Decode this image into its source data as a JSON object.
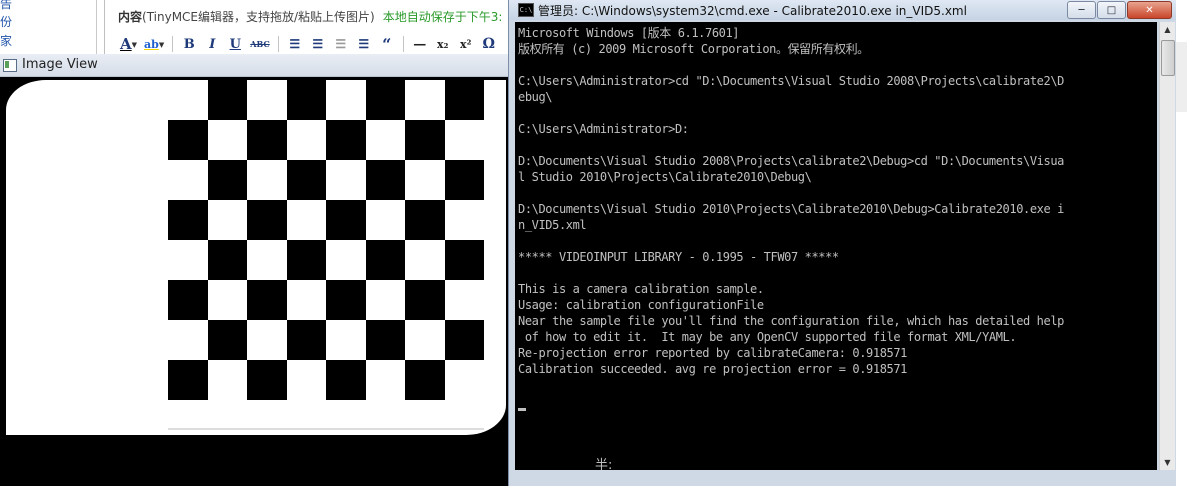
{
  "left_nav": {
    "items": [
      "告",
      "份",
      "家"
    ]
  },
  "editor": {
    "content_label": "内容",
    "content_hint": "(TinyMCE编辑器，支持拖放/粘贴上传图片)",
    "autosave": "本地自动保存于下午3:",
    "toolbar": [
      "A",
      "ab",
      "B",
      "I",
      "U",
      "ABC",
      "☰",
      "☰",
      "☰",
      "☰",
      "“",
      "—",
      "x₂",
      "x²",
      "Ω"
    ]
  },
  "image_view": {
    "title": "Image View",
    "board": {
      "columns": 8,
      "rows": 8
    }
  },
  "cmd_window": {
    "title": "管理员: C:\\Windows\\system32\\cmd.exe - Calibrate2010.exe  in_VID5.xml",
    "controls": {
      "minimize": "─",
      "maximize": "□",
      "close": "✕"
    },
    "output": "Microsoft Windows [版本 6.1.7601]\n版权所有 (c) 2009 Microsoft Corporation。保留所有权利。\n\nC:\\Users\\Administrator>cd \"D:\\Documents\\Visual Studio 2008\\Projects\\calibrate2\\D\nebug\\\n\nC:\\Users\\Administrator>D:\n\nD:\\Documents\\Visual Studio 2008\\Projects\\calibrate2\\Debug>cd \"D:\\Documents\\Visua\nl Studio 2010\\Projects\\Calibrate2010\\Debug\\\n\nD:\\Documents\\Visual Studio 2010\\Projects\\Calibrate2010\\Debug>Calibrate2010.exe i\nn_VID5.xml\n\n***** VIDEOINPUT LIBRARY - 0.1995 - TFW07 *****\n\nThis is a camera calibration sample.\nUsage: calibration configurationFile\nNear the sample file you'll find the configuration file, which has detailed help\n of how to edit it.  It may be any OpenCV supported file format XML/YAML.\nRe-projection error reported by calibrateCamera: 0.918571\nCalibration succeeded. avg re projection error = 0.918571",
    "ime_status": "半:",
    "icon_text": "C:\\"
  },
  "colors": {
    "cmd_bg": "#000000",
    "cmd_text": "#c0c0c0",
    "autosave": "#2a9a2a",
    "close_btn": "#c9452a"
  }
}
